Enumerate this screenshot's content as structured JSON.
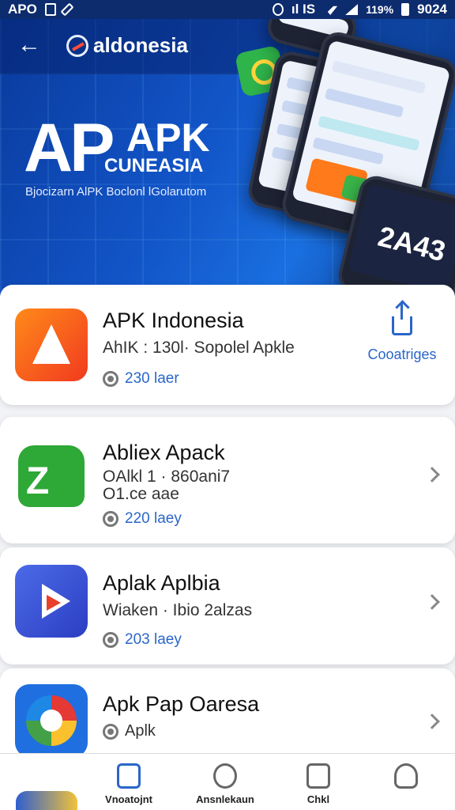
{
  "status_bar": {
    "left_text": "APO",
    "right_text": "ıl IS",
    "battery_text": "119%",
    "time": "9024"
  },
  "hero": {
    "back_icon": "back-arrow-icon",
    "brand": "aldonesia",
    "big_text": "AP",
    "apk_text": "APK",
    "sub_text": "CUNEASIA",
    "tagline": "Bjocizarn AlPK Boclonl lGolarutom",
    "phone_number": "2A43"
  },
  "apps": [
    {
      "title": "APK Indonesia",
      "meta": "AhIK : 130l·  Sopolel Apkle",
      "rating": "230 laer",
      "action_label": "Cooatriges",
      "icon": "apk-indonesia-icon"
    },
    {
      "title": "Abliex Apack",
      "meta_line1": "OAlkl 1  ·   860ani7",
      "meta_line2": "O1.ce aae",
      "rating": "220 laey",
      "icon": "abliex-apack-icon"
    },
    {
      "title": "Aplak Aplbia",
      "meta": "Wiaken   ·  Ibio 2alzas",
      "rating": "203 laey",
      "icon": "aplak-aplbia-icon"
    },
    {
      "title": "Apk Pap Oaresa",
      "meta": "Aplk",
      "icon": "apk-pap-oaresa-icon"
    }
  ],
  "bottom_nav": [
    {
      "label": "Vnoatojnt",
      "icon": "tabs-icon",
      "active": true
    },
    {
      "label": "Ansnlekaun",
      "icon": "search-icon",
      "active": false
    },
    {
      "label": "Chkl",
      "icon": "book-icon",
      "active": false
    },
    {
      "label": "",
      "icon": "profile-icon",
      "active": false
    }
  ],
  "colors": {
    "accent": "#2a66c9",
    "hero_blue": "#1255c8",
    "status_bar": "#0d2c6e"
  }
}
